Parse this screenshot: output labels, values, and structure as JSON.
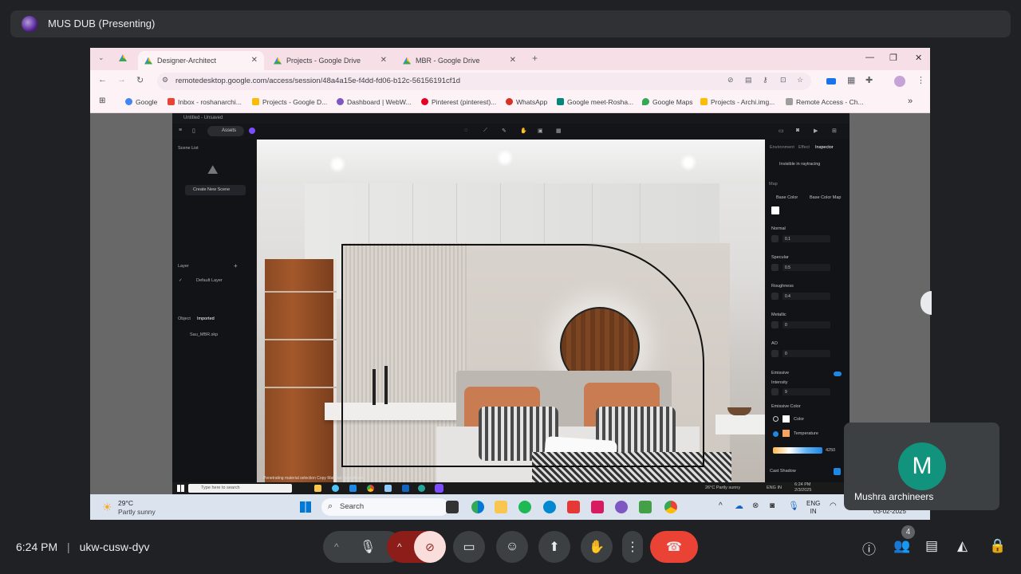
{
  "meet": {
    "presenter_title": "MUS DUB (Presenting)",
    "time": "6:24 PM",
    "separator": "|",
    "meeting_code": "ukw-cusw-dyv",
    "participant_initial": "M",
    "participant_name": "Mushra archineers",
    "people_count": "4",
    "colors": {
      "end_call": "#ea4335",
      "camera_off": "#f9dedc",
      "avatar": "#12937e"
    }
  },
  "browser": {
    "tabs": [
      {
        "label": "Designer-Architect"
      },
      {
        "label": "Projects - Google Drive"
      },
      {
        "label": "MBR - Google Drive"
      }
    ],
    "url": "remotedesktop.google.com/access/session/48a4a15e-f4dd-fd06-b12c-56156191cf1d",
    "bookmarks": [
      {
        "label": "Google"
      },
      {
        "label": "Inbox - roshanarchi..."
      },
      {
        "label": "Projects - Google D..."
      },
      {
        "label": "Dashboard | WebW..."
      },
      {
        "label": "Pinterest (pinterest)..."
      },
      {
        "label": "WhatsApp"
      },
      {
        "label": "Google meet-Rosha..."
      },
      {
        "label": "Google Maps"
      },
      {
        "label": "Projects - Archi.img..."
      },
      {
        "label": "Remote Access - Ch..."
      }
    ]
  },
  "remote_app": {
    "window_title": "Untitled - Unsaved",
    "assets_label": "Assets",
    "scene_list_label": "Scene List",
    "create_scene_label": "Create New Scene",
    "layer_label": "Layer",
    "default_layer": "Default Layer",
    "object_label": "Object",
    "imported_label": "Imported",
    "file_name": "Sau_MBR.skp",
    "viewport_status": "Penetrating material selection   Copy Material   Open Asset",
    "inspector": {
      "tabs": [
        "Environment",
        "Effect",
        "Inspector"
      ],
      "invisible_label": "Invisible in raytracing",
      "map_label": "Map",
      "base_color": "Base Color",
      "base_color_map": "Base Color Map",
      "normal_label": "Normal",
      "normal_value": "0.1",
      "specular_label": "Specular",
      "specular_value": "0.5",
      "roughness_label": "Roughness",
      "roughness_value": "0.4",
      "metallic_label": "Metallic",
      "metallic_value": "0",
      "ao_label": "AO",
      "ao_value": "0",
      "emissive_label": "Emissive",
      "intensity_label": "Intensity",
      "intensity_value": "9",
      "emissive_color_label": "Emissive Color",
      "color_option": "Color",
      "temperature_option": "Temperature",
      "temperature_value": "4250",
      "cast_shadow_label": "Cast Shadow"
    },
    "taskbar": {
      "search_placeholder": "Type here to search",
      "weather": "26°C  Partly sunny",
      "tray_lang": "ENG IN",
      "time": "6:24 PM",
      "date": "2/3/2025"
    }
  },
  "local_taskbar": {
    "weather_temp": "29°C",
    "weather_desc": "Partly sunny",
    "search_label": "Search",
    "tray_lang_1": "ENG",
    "tray_lang_2": "IN",
    "date": "03-02-2025"
  }
}
